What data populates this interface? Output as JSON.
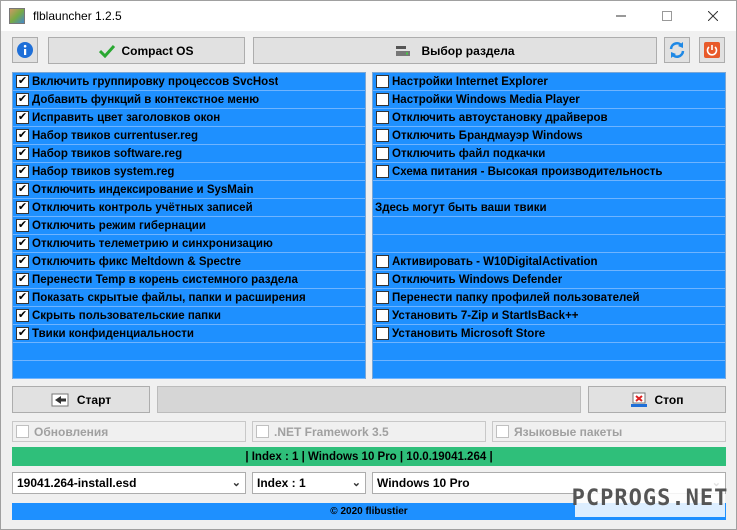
{
  "window": {
    "title": "flblauncher 1.2.5"
  },
  "toolbar": {
    "compact_os_label": "Compact OS",
    "choose_section_label": "Выбор раздела"
  },
  "left_list": [
    {
      "label": "Включить группировку процессов SvcHost",
      "checked": true
    },
    {
      "label": "Добавить функций в контекстное меню",
      "checked": true
    },
    {
      "label": "Исправить цвет заголовков окон",
      "checked": true
    },
    {
      "label": "Набор твиков currentuser.reg",
      "checked": true
    },
    {
      "label": "Набор твиков software.reg",
      "checked": true
    },
    {
      "label": "Набор твиков system.reg",
      "checked": true
    },
    {
      "label": "Отключить индексирование и SysMain",
      "checked": true
    },
    {
      "label": "Отключить контроль учётных записей",
      "checked": true
    },
    {
      "label": "Отключить режим гибернации",
      "checked": true
    },
    {
      "label": "Отключить телеметрию и синхронизацию",
      "checked": true
    },
    {
      "label": "Отключить фикс Meltdown & Spectre",
      "checked": true
    },
    {
      "label": "Перенести Temp в корень системного раздела",
      "checked": true
    },
    {
      "label": "Показать скрытые файлы, папки и расширения",
      "checked": true
    },
    {
      "label": "Скрыть пользовательские папки",
      "checked": true
    },
    {
      "label": "Твики конфиденциальности",
      "checked": true
    }
  ],
  "right_list_top": [
    {
      "label": "Настройки Internet Explorer",
      "checked": false
    },
    {
      "label": "Настройки Windows Media Player",
      "checked": false
    },
    {
      "label": "Отключить автоустановку драйверов",
      "checked": false
    },
    {
      "label": "Отключить Брандмауэр Windows",
      "checked": false
    },
    {
      "label": "Отключить файл подкачки",
      "checked": false
    },
    {
      "label": "Схема питания - Высокая производительность",
      "checked": false
    }
  ],
  "right_note": "Здесь могут быть ваши твики",
  "right_list_bottom": [
    {
      "label": "Активировать - W10DigitalActivation",
      "checked": false
    },
    {
      "label": "Отключить Windows Defender",
      "checked": false
    },
    {
      "label": "Перенести папку профилей пользователей",
      "checked": false
    },
    {
      "label": "Установить 7-Zip и StartIsBack++",
      "checked": false
    },
    {
      "label": "Установить Microsoft Store",
      "checked": false
    }
  ],
  "actions": {
    "start_label": "Старт",
    "stop_label": "Стоп"
  },
  "options": {
    "updates_label": "Обновления",
    "netfx_label": ".NET Framework 3.5",
    "lang_label": "Языковые пакеты"
  },
  "info": "| Index : 1 | Windows 10 Pro | 10.0.19041.264 |",
  "combos": {
    "image_file": "19041.264-install.esd",
    "index": "Index : 1",
    "edition": "Windows 10 Pro"
  },
  "footer": "© 2020 flibustier",
  "watermark": "PCPROGS.NET",
  "colors": {
    "panel": "#1e90ff",
    "info_bar": "#2fbf7a",
    "check_green": "#2aa832",
    "refresh_blue": "#1e88e5",
    "power_red": "#e85a2a"
  }
}
